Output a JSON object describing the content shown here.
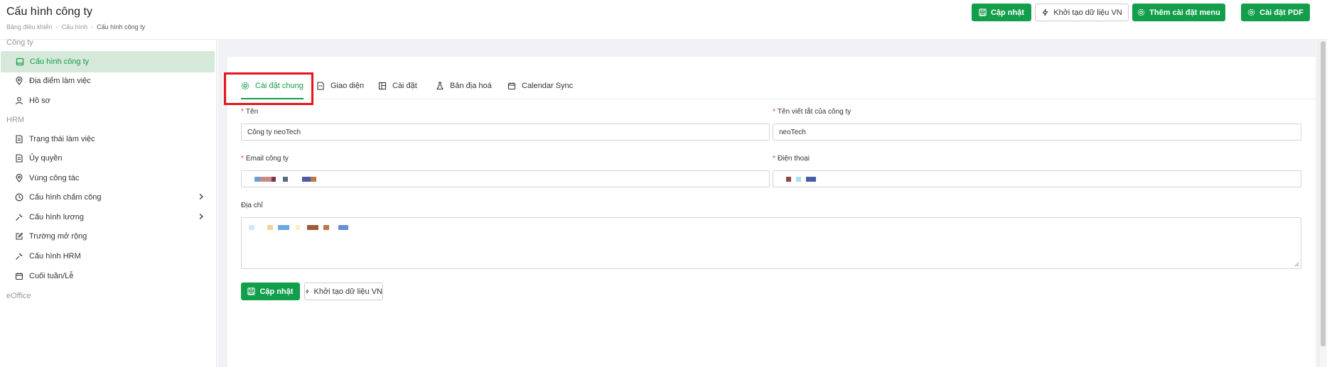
{
  "header": {
    "title": "Cấu hình công ty",
    "breadcrumb": [
      "Bảng điều khiển",
      "Cấu hình",
      "Cấu hình công ty"
    ],
    "buttons": {
      "update": "Cập nhật",
      "init_vn": "Khởi tạo dữ liệu VN",
      "add_menu": "Thêm cài đặt menu",
      "pdf": "Cài đặt PDF"
    }
  },
  "sidebar": {
    "sections": [
      "Công ty",
      "HRM",
      "eOffice"
    ],
    "items": [
      {
        "label": "Cấu hình công ty",
        "icon": "building-icon",
        "active": true
      },
      {
        "label": "Địa điểm làm việc",
        "icon": "map-pin-icon"
      },
      {
        "label": "Hồ sơ",
        "icon": "user-icon"
      },
      {
        "label": "Trạng thái làm việc",
        "icon": "document-icon"
      },
      {
        "label": "Ủy quyền",
        "icon": "document-icon"
      },
      {
        "label": "Vùng công tác",
        "icon": "map-pin-icon"
      },
      {
        "label": "Cấu hình chấm công",
        "icon": "clock-icon",
        "has_submenu": true
      },
      {
        "label": "Cấu hình lương",
        "icon": "wrench-icon",
        "has_submenu": true
      },
      {
        "label": "Trường mở rộng",
        "icon": "edit-icon"
      },
      {
        "label": "Cấu hình HRM",
        "icon": "wrench-icon"
      },
      {
        "label": "Cuối tuần/Lễ",
        "icon": "calendar-icon"
      }
    ]
  },
  "tabs": [
    {
      "label": "Cài đặt chung",
      "icon": "gear-icon",
      "active": true
    },
    {
      "label": "Giao diện",
      "icon": "file-icon"
    },
    {
      "label": "Cài đặt",
      "icon": "layout-icon"
    },
    {
      "label": "Bản địa hoá",
      "icon": "flask-icon"
    },
    {
      "label": "Calendar Sync",
      "icon": "calendar-icon"
    }
  ],
  "form": {
    "name": {
      "label": "Tên",
      "required": true,
      "value": "Công ty neoTech"
    },
    "short_name": {
      "label": "Tên viết tắt của công ty",
      "required": true,
      "value": "neoTech"
    },
    "email": {
      "label": "Email công ty",
      "required": true
    },
    "phone": {
      "label": "Điện thoại",
      "required": true
    },
    "address": {
      "label": "Địa chỉ"
    },
    "buttons": {
      "update": "Cập nhật",
      "init_vn": "Khởi tạo dữ liệu VN"
    }
  },
  "colors": {
    "primary": "#129e4a",
    "active_bg": "#d6e8da",
    "highlight": "#e8141b",
    "required": "#e53935"
  }
}
